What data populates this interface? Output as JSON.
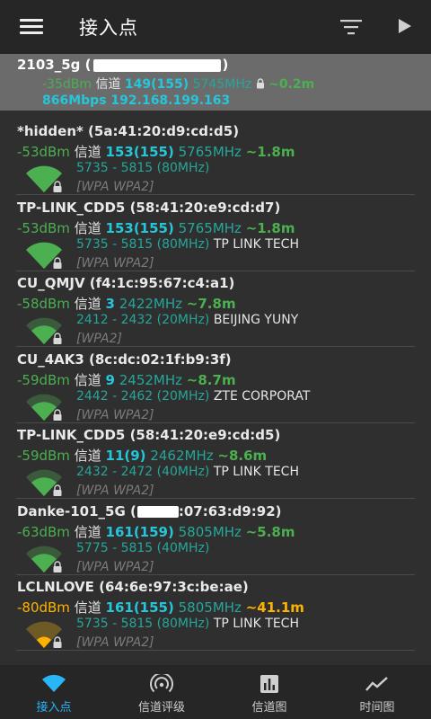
{
  "appbar": {
    "title": "接入点"
  },
  "connected": {
    "ssid": "2103_5g (",
    "bssid_tail": ")",
    "dbm": "-35dBm",
    "channel_label": "信道",
    "channel": "149(155)",
    "freq": "5745MHz",
    "dist": "~0.2m",
    "rate_ip": "866Mbps 192.168.199.163"
  },
  "aps": [
    {
      "name": "*hidden* (5a:41:20:d9:cd:d5)",
      "dbm": "-53dBm",
      "channel_label": "信道",
      "channel": "153(155)",
      "freq": "5765MHz",
      "dist": "~1.8m",
      "range": "5735 - 5815 (80MHz)",
      "vendor": "",
      "security": "[WPA WPA2]",
      "level": "strong"
    },
    {
      "name": "TP-LINK_CDD5 (58:41:20:e9:cd:d7)",
      "dbm": "-53dBm",
      "channel_label": "信道",
      "channel": "153(155)",
      "freq": "5765MHz",
      "dist": "~1.8m",
      "range": "5735 - 5815 (80MHz)",
      "vendor": "TP LINK TECH",
      "security": "[WPA WPA2]",
      "level": "strong"
    },
    {
      "name": "CU_QMJV (f4:1c:95:67:c4:a1)",
      "dbm": "-58dBm",
      "channel_label": "信道",
      "channel": "3",
      "freq": "2422MHz",
      "dist": "~7.8m",
      "range": "2412 - 2432 (20MHz)",
      "vendor": "BEIJING YUNY",
      "security": "[WPA2]",
      "level": "medium"
    },
    {
      "name": "CU_4AK3 (8c:dc:02:1f:b9:3f)",
      "dbm": "-59dBm",
      "channel_label": "信道",
      "channel": "9",
      "freq": "2452MHz",
      "dist": "~8.7m",
      "range": "2442 - 2462 (20MHz)",
      "vendor": "ZTE CORPORAT",
      "security": "[WPA WPA2]",
      "level": "medium"
    },
    {
      "name": "TP-LINK_CDD5 (58:41:20:e9:cd:d5)",
      "dbm": "-59dBm",
      "channel_label": "信道",
      "channel": "11(9)",
      "freq": "2462MHz",
      "dist": "~8.6m",
      "range": "2432 - 2472 (40MHz)",
      "vendor": "TP LINK TECH",
      "security": "[WPA WPA2]",
      "level": "medium"
    },
    {
      "name": "Danke-101_5G (",
      "name_tail": ":07:63:d9:92)",
      "dbm": "-63dBm",
      "channel_label": "信道",
      "channel": "161(159)",
      "freq": "5805MHz",
      "dist": "~5.8m",
      "range": "5775 - 5815 (40MHz)",
      "vendor": "",
      "security": "[WPA WPA2]",
      "level": "medium"
    },
    {
      "name": "LCLNLOVE (64:6e:97:3c:be:ae)",
      "dbm": "-80dBm",
      "channel_label": "信道",
      "channel": "161(155)",
      "freq": "5805MHz",
      "dist": "~41.1m",
      "range": "5735 - 5815 (80MHz)",
      "vendor": "TP LINK TECH",
      "security": "[WPA WPA2]",
      "level": "weak"
    }
  ],
  "tabs": [
    {
      "label": "接入点",
      "icon": "wifi-icon"
    },
    {
      "label": "信道评级",
      "icon": "signal-rating-icon"
    },
    {
      "label": "信道图",
      "icon": "bar-chart-icon"
    },
    {
      "label": "时间图",
      "icon": "line-chart-icon"
    }
  ],
  "colors": {
    "strong": "#4caf50",
    "medium": "#4caf50",
    "weak": "#ffb300",
    "accent": "#29b6f6",
    "channel": "#26c6da",
    "range": "#26a69a"
  }
}
